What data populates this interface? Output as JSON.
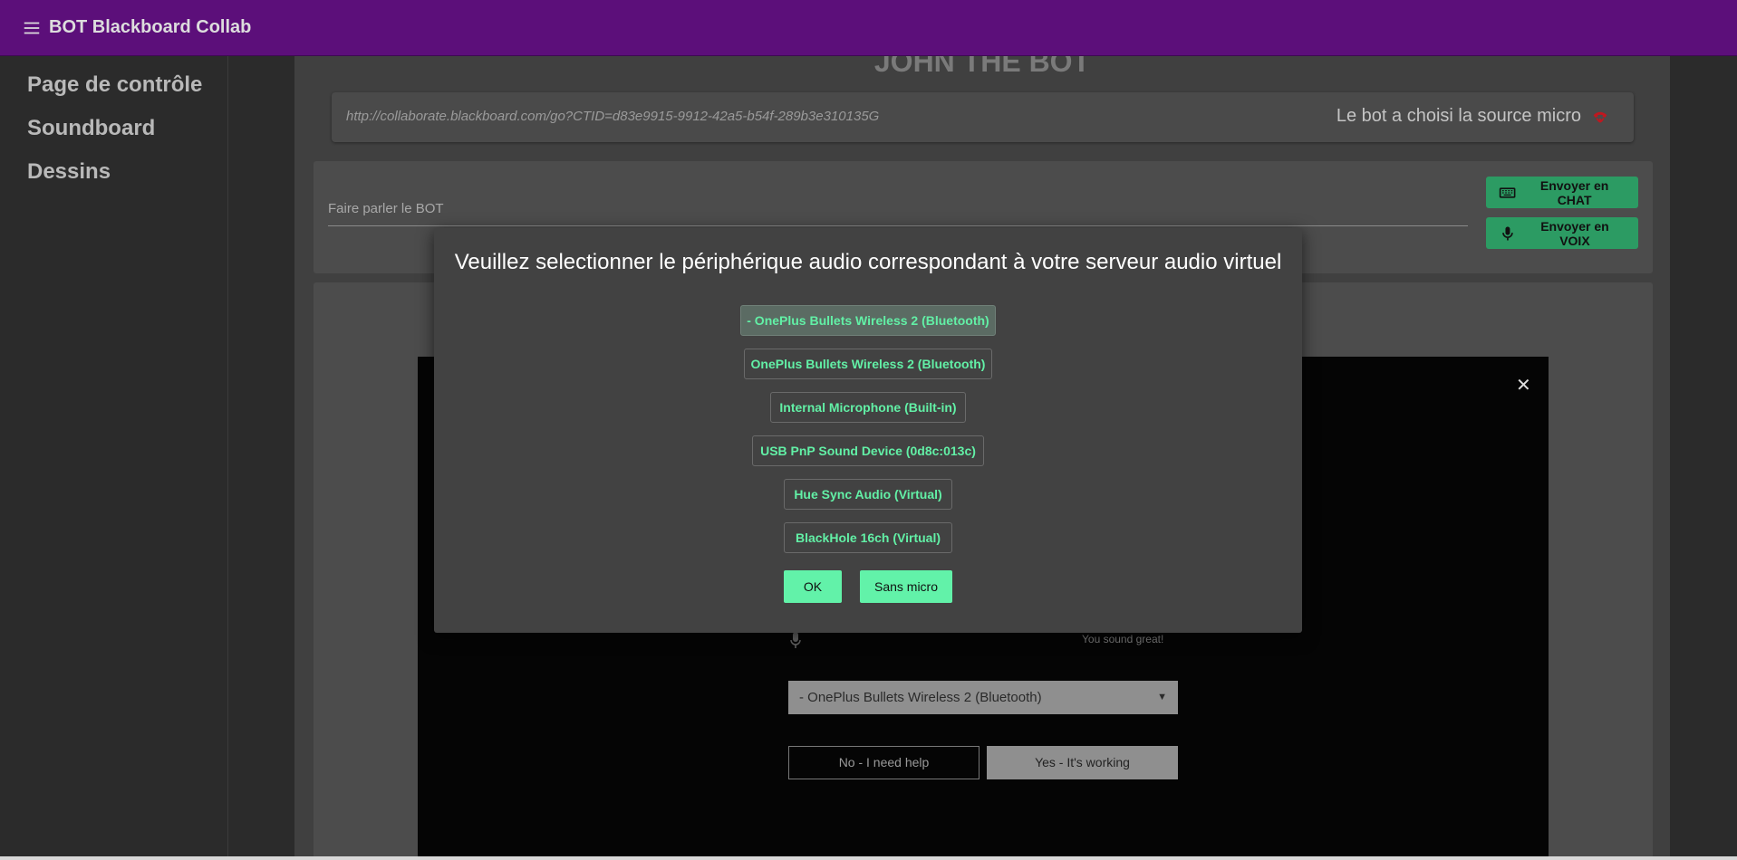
{
  "appbar": {
    "title": "BOT Blackboard Collab",
    "menu_icon": "menu-icon"
  },
  "sidebar": {
    "items": [
      {
        "label": "Page de contrôle"
      },
      {
        "label": "Soundboard"
      },
      {
        "label": "Dessins"
      }
    ]
  },
  "main": {
    "bot_name": "JOHN THE BOT",
    "url": "http://collaborate.blackboard.com/go?CTID=d83e9915-9912-42a5-b54f-289b3e310135G",
    "source_status": "Le bot a choisi la source micro",
    "source_icon": "phone-off-icon",
    "talk_placeholder": "Faire parler le BOT",
    "send_chat_label": "Envoyer en CHAT",
    "send_voice_label": "Envoyer en VOIX"
  },
  "background_panel": {
    "sound_status": "You sound great!",
    "selected_device": "- OnePlus Bullets Wireless 2 (Bluetooth)",
    "help_label": "No - I need help",
    "working_label": "Yes - It's working",
    "close_icon": "close-icon"
  },
  "modal": {
    "title": "Veuillez selectionner le périphérique audio correspondant à votre serveur audio virtuel",
    "devices": [
      {
        "label": "- OnePlus Bullets Wireless 2 (Bluetooth)",
        "selected": true
      },
      {
        "label": "OnePlus Bullets Wireless 2 (Bluetooth)",
        "selected": false
      },
      {
        "label": "Internal Microphone (Built-in)",
        "selected": false
      },
      {
        "label": "USB PnP Sound Device (0d8c:013c)",
        "selected": false
      },
      {
        "label": "Hue Sync Audio (Virtual)",
        "selected": false
      },
      {
        "label": "BlackHole 16ch (Virtual)",
        "selected": false
      }
    ],
    "ok_label": "OK",
    "no_mic_label": "Sans micro"
  },
  "colors": {
    "appbar": "#5c0f7a",
    "accent_green": "#62f2a9",
    "button_green": "#2c9b63",
    "background": "#2b2b2b"
  }
}
